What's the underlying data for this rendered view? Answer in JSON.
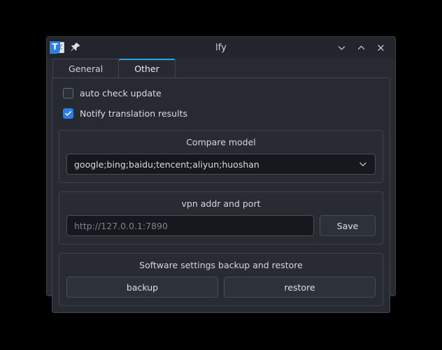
{
  "window": {
    "title": "lfy",
    "app_icon": "translate-app-icon",
    "pin_icon": "pin-icon",
    "controls": [
      {
        "name": "minimize-button",
        "icon": "chevron-down-icon"
      },
      {
        "name": "maximize-button",
        "icon": "chevron-up-icon"
      },
      {
        "name": "close-button",
        "icon": "close-icon"
      }
    ]
  },
  "tabs": [
    {
      "label": "General",
      "active": false
    },
    {
      "label": "Other",
      "active": true
    }
  ],
  "checkboxes": [
    {
      "label": "auto check update",
      "checked": false
    },
    {
      "label": "Notify translation results",
      "checked": true
    }
  ],
  "compare_model": {
    "title": "Compare model",
    "selected": "google;bing;baidu;tencent;aliyun;huoshan",
    "chevron_icon": "chevron-down-icon"
  },
  "vpn": {
    "title": "vpn addr and port",
    "placeholder": "http://127.0.0.1:7890",
    "value": "",
    "save_label": "Save"
  },
  "backup": {
    "title": "Software settings backup and restore",
    "backup_label": "backup",
    "restore_label": "restore"
  },
  "colors": {
    "accent": "#2ea0e8",
    "checkbox_on": "#2b7de9",
    "window_bg": "#272a30",
    "titlebar_bg": "#22252b",
    "input_bg": "#16181d",
    "border": "#41464e",
    "desktop_bg": "#000000"
  }
}
